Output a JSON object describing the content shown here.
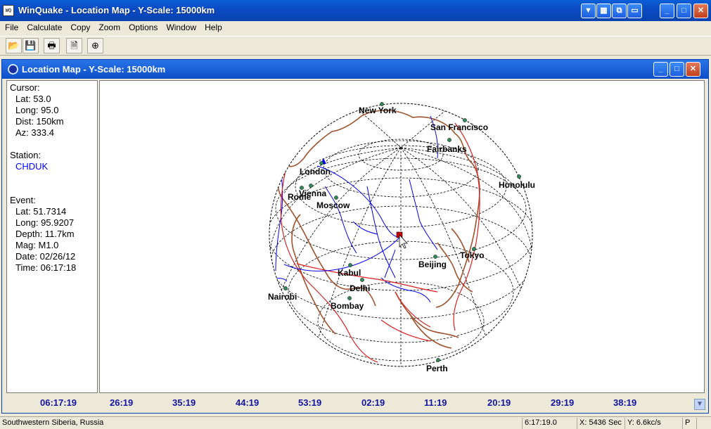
{
  "window": {
    "title": "WinQuake - Location Map - Y-Scale: 15000km"
  },
  "menu": [
    "File",
    "Calculate",
    "Copy",
    "Zoom",
    "Options",
    "Window",
    "Help"
  ],
  "toolbar": {
    "icons": [
      "open-folder-icon",
      "save-icon",
      "print-icon",
      "page-icon",
      "crosshair-icon"
    ]
  },
  "child_window": {
    "title": "Location Map - Y-Scale: 15000km"
  },
  "info": {
    "cursor_label": "Cursor:",
    "lat": "Lat: 53.0",
    "long": "Long: 95.0",
    "dist": "Dist: 150km",
    "az": "Az: 333.4",
    "station_label": "Station:",
    "station": "CHDUK",
    "event_label": "Event:",
    "ev_lat": "Lat: 51.7314",
    "ev_long": "Long: 95.9207",
    "ev_depth": "Depth: 11.7km",
    "ev_mag": "Mag: M1.0",
    "ev_date": "Date: 02/26/12",
    "ev_time": "Time: 06:17:18"
  },
  "map": {
    "cities": [
      "New York",
      "San Francisco",
      "Fairbanks",
      "London",
      "Honolulu",
      "Vienna",
      "Rome",
      "Moscow",
      "Tokyo",
      "Beijing",
      "Kabul",
      "Delhi",
      "Nairobi",
      "Bombay",
      "Perth"
    ],
    "colors": {
      "graticule": "#000000",
      "coast": "#a0522d",
      "rivers": "#0000ff",
      "plates": "#e02020",
      "city": "#2e8b57",
      "event": "#cc0000"
    }
  },
  "timeline": [
    "06:17:19",
    "26:19",
    "35:19",
    "44:19",
    "53:19",
    "02:19",
    "11:19",
    "20:19",
    "29:19",
    "38:19"
  ],
  "status": {
    "region": "Southwestern Siberia, Russia",
    "time": "6:17:19.0",
    "x": "X: 5436 Sec",
    "y": "Y: 6.6kc/s",
    "p": "P"
  }
}
